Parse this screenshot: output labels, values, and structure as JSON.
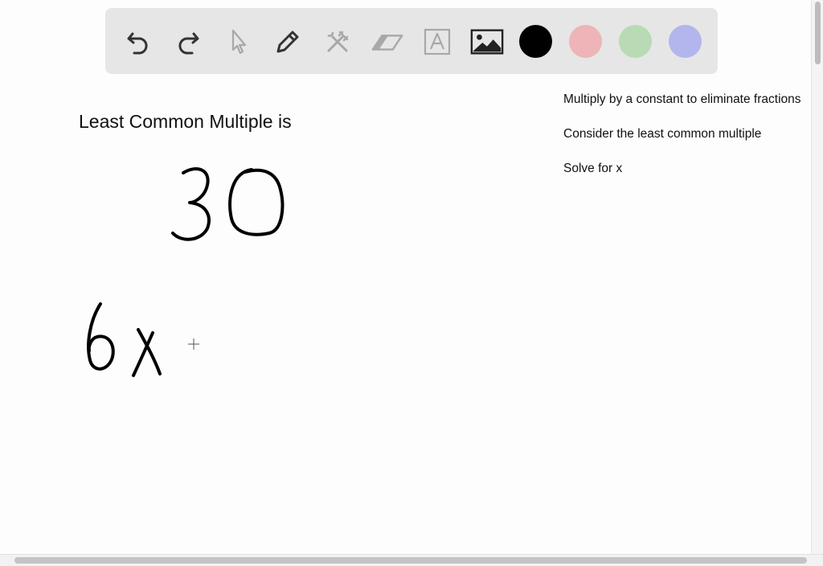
{
  "toolbar": {
    "tools": [
      {
        "icon": "undo-icon",
        "enabled": true
      },
      {
        "icon": "redo-icon",
        "enabled": true
      },
      {
        "icon": "pointer-icon",
        "enabled": false
      },
      {
        "icon": "pencil-icon",
        "enabled": true
      },
      {
        "icon": "tools-icon",
        "enabled": false
      },
      {
        "icon": "eraser-icon",
        "enabled": false
      },
      {
        "icon": "text-icon",
        "enabled": false
      },
      {
        "icon": "image-icon",
        "enabled": true
      }
    ],
    "colors": [
      "#000000",
      "#eeb4b8",
      "#b8dab4",
      "#b3b6ec"
    ],
    "selected_color": "#000000"
  },
  "board": {
    "heading": "Least Common Multiple is",
    "handwriting": {
      "line1": "30",
      "line2": "6x"
    }
  },
  "steps": [
    "Multiply by a constant to eliminate fractions",
    "Consider the least common multiple",
    "Solve for x"
  ]
}
